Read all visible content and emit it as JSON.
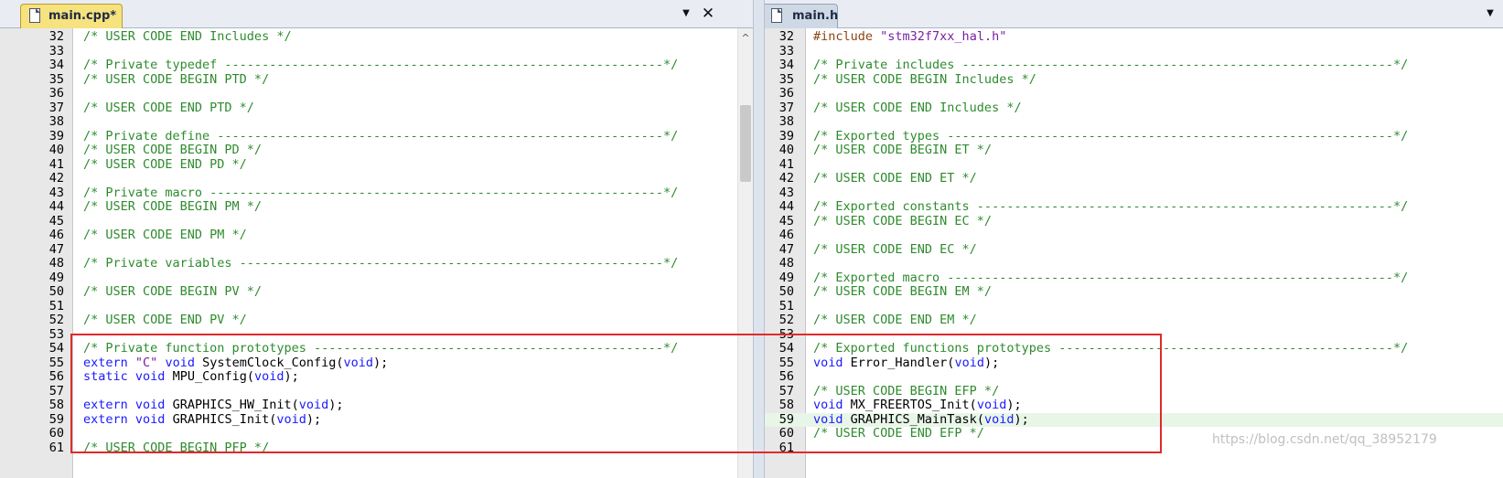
{
  "left_pane": {
    "tab_label": "main.cpp*",
    "lines": [
      {
        "num": "32",
        "tokens": [
          {
            "t": "/* USER CODE END Includes */",
            "c": "comment"
          }
        ]
      },
      {
        "num": "33",
        "tokens": []
      },
      {
        "num": "34",
        "tokens": [
          {
            "t": "/* Private typedef -----------------------------------------------------------*/",
            "c": "comment"
          }
        ]
      },
      {
        "num": "35",
        "tokens": [
          {
            "t": "/* USER CODE BEGIN PTD */",
            "c": "comment"
          }
        ]
      },
      {
        "num": "36",
        "tokens": []
      },
      {
        "num": "37",
        "tokens": [
          {
            "t": "/* USER CODE END PTD */",
            "c": "comment"
          }
        ]
      },
      {
        "num": "38",
        "tokens": []
      },
      {
        "num": "39",
        "tokens": [
          {
            "t": "/* Private define ------------------------------------------------------------*/",
            "c": "comment"
          }
        ]
      },
      {
        "num": "40",
        "tokens": [
          {
            "t": "/* USER CODE BEGIN PD */",
            "c": "comment"
          }
        ]
      },
      {
        "num": "41",
        "tokens": [
          {
            "t": "/* USER CODE END PD */",
            "c": "comment"
          }
        ]
      },
      {
        "num": "42",
        "tokens": []
      },
      {
        "num": "43",
        "tokens": [
          {
            "t": "/* Private macro -------------------------------------------------------------*/",
            "c": "comment"
          }
        ]
      },
      {
        "num": "44",
        "tokens": [
          {
            "t": "/* USER CODE BEGIN PM */",
            "c": "comment"
          }
        ]
      },
      {
        "num": "45",
        "tokens": []
      },
      {
        "num": "46",
        "tokens": [
          {
            "t": "/* USER CODE END PM */",
            "c": "comment"
          }
        ]
      },
      {
        "num": "47",
        "tokens": []
      },
      {
        "num": "48",
        "tokens": [
          {
            "t": "/* Private variables ---------------------------------------------------------*/",
            "c": "comment"
          }
        ]
      },
      {
        "num": "49",
        "tokens": []
      },
      {
        "num": "50",
        "tokens": [
          {
            "t": "/* USER CODE BEGIN PV */",
            "c": "comment"
          }
        ]
      },
      {
        "num": "51",
        "tokens": []
      },
      {
        "num": "52",
        "tokens": [
          {
            "t": "/* USER CODE END PV */",
            "c": "comment"
          }
        ]
      },
      {
        "num": "53",
        "tokens": []
      },
      {
        "num": "54",
        "tokens": [
          {
            "t": "/* Private function prototypes -----------------------------------------------*/",
            "c": "comment"
          }
        ]
      },
      {
        "num": "55",
        "tokens": [
          {
            "t": "extern",
            "c": "keyword"
          },
          {
            "t": " ",
            "c": "plain"
          },
          {
            "t": "\"C\"",
            "c": "string"
          },
          {
            "t": " ",
            "c": "plain"
          },
          {
            "t": "void",
            "c": "keyword"
          },
          {
            "t": " SystemClock_Config(",
            "c": "plain"
          },
          {
            "t": "void",
            "c": "keyword"
          },
          {
            "t": ");",
            "c": "plain"
          }
        ]
      },
      {
        "num": "56",
        "tokens": [
          {
            "t": "static",
            "c": "keyword"
          },
          {
            "t": " ",
            "c": "plain"
          },
          {
            "t": "void",
            "c": "keyword"
          },
          {
            "t": " MPU_Config(",
            "c": "plain"
          },
          {
            "t": "void",
            "c": "keyword"
          },
          {
            "t": ");",
            "c": "plain"
          }
        ]
      },
      {
        "num": "57",
        "tokens": []
      },
      {
        "num": "58",
        "tokens": [
          {
            "t": "extern",
            "c": "keyword"
          },
          {
            "t": " ",
            "c": "plain"
          },
          {
            "t": "void",
            "c": "keyword"
          },
          {
            "t": " GRAPHICS_HW_Init(",
            "c": "plain"
          },
          {
            "t": "void",
            "c": "keyword"
          },
          {
            "t": ");",
            "c": "plain"
          }
        ]
      },
      {
        "num": "59",
        "tokens": [
          {
            "t": "extern",
            "c": "keyword"
          },
          {
            "t": " ",
            "c": "plain"
          },
          {
            "t": "void",
            "c": "keyword"
          },
          {
            "t": " GRAPHICS_Init(",
            "c": "plain"
          },
          {
            "t": "void",
            "c": "keyword"
          },
          {
            "t": ");",
            "c": "plain"
          }
        ]
      },
      {
        "num": "60",
        "tokens": []
      },
      {
        "num": "61",
        "tokens": [
          {
            "t": "/* USER CODE BEGIN PFP */",
            "c": "comment"
          }
        ]
      }
    ]
  },
  "right_pane": {
    "tab_label": "main.h",
    "lines": [
      {
        "num": "32",
        "tokens": [
          {
            "t": "#include ",
            "c": "preproc"
          },
          {
            "t": "\"stm32f7xx_hal.h\"",
            "c": "string"
          }
        ]
      },
      {
        "num": "33",
        "tokens": []
      },
      {
        "num": "34",
        "tokens": [
          {
            "t": "/* Private includes ----------------------------------------------------------*/",
            "c": "comment"
          }
        ]
      },
      {
        "num": "35",
        "tokens": [
          {
            "t": "/* USER CODE BEGIN Includes */",
            "c": "comment"
          }
        ]
      },
      {
        "num": "36",
        "tokens": []
      },
      {
        "num": "37",
        "tokens": [
          {
            "t": "/* USER CODE END Includes */",
            "c": "comment"
          }
        ]
      },
      {
        "num": "38",
        "tokens": []
      },
      {
        "num": "39",
        "tokens": [
          {
            "t": "/* Exported types ------------------------------------------------------------*/",
            "c": "comment"
          }
        ]
      },
      {
        "num": "40",
        "tokens": [
          {
            "t": "/* USER CODE BEGIN ET */",
            "c": "comment"
          }
        ]
      },
      {
        "num": "41",
        "tokens": []
      },
      {
        "num": "42",
        "tokens": [
          {
            "t": "/* USER CODE END ET */",
            "c": "comment"
          }
        ]
      },
      {
        "num": "43",
        "tokens": []
      },
      {
        "num": "44",
        "tokens": [
          {
            "t": "/* Exported constants --------------------------------------------------------*/",
            "c": "comment"
          }
        ]
      },
      {
        "num": "45",
        "tokens": [
          {
            "t": "/* USER CODE BEGIN EC */",
            "c": "comment"
          }
        ]
      },
      {
        "num": "46",
        "tokens": []
      },
      {
        "num": "47",
        "tokens": [
          {
            "t": "/* USER CODE END EC */",
            "c": "comment"
          }
        ]
      },
      {
        "num": "48",
        "tokens": []
      },
      {
        "num": "49",
        "tokens": [
          {
            "t": "/* Exported macro ------------------------------------------------------------*/",
            "c": "comment"
          }
        ]
      },
      {
        "num": "50",
        "tokens": [
          {
            "t": "/* USER CODE BEGIN EM */",
            "c": "comment"
          }
        ]
      },
      {
        "num": "51",
        "tokens": []
      },
      {
        "num": "52",
        "tokens": [
          {
            "t": "/* USER CODE END EM */",
            "c": "comment"
          }
        ]
      },
      {
        "num": "53",
        "tokens": []
      },
      {
        "num": "54",
        "tokens": [
          {
            "t": "/* Exported functions prototypes ---------------------------------------------*/",
            "c": "comment"
          }
        ]
      },
      {
        "num": "55",
        "tokens": [
          {
            "t": "void",
            "c": "keyword"
          },
          {
            "t": " Error_Handler(",
            "c": "plain"
          },
          {
            "t": "void",
            "c": "keyword"
          },
          {
            "t": ");",
            "c": "plain"
          }
        ]
      },
      {
        "num": "56",
        "tokens": []
      },
      {
        "num": "57",
        "tokens": [
          {
            "t": "/* USER CODE BEGIN EFP */",
            "c": "comment"
          }
        ]
      },
      {
        "num": "58",
        "tokens": [
          {
            "t": "void",
            "c": "keyword"
          },
          {
            "t": " MX_FREERTOS_Init(",
            "c": "plain"
          },
          {
            "t": "void",
            "c": "keyword"
          },
          {
            "t": ");",
            "c": "plain"
          }
        ]
      },
      {
        "num": "59",
        "highlight": true,
        "tokens": [
          {
            "t": "void",
            "c": "keyword"
          },
          {
            "t": " GRAPHICS_MainTask(",
            "c": "plain"
          },
          {
            "t": "void",
            "c": "keyword"
          },
          {
            "t": ");",
            "c": "plain"
          }
        ]
      },
      {
        "num": "60",
        "tokens": [
          {
            "t": "/* USER CODE END EFP */",
            "c": "comment"
          }
        ]
      },
      {
        "num": "61",
        "tokens": []
      }
    ]
  },
  "icons": {
    "file": "file-icon",
    "dropdown": "chevron-down-icon",
    "close": "close-icon",
    "scroll_up": "scroll-up-icon"
  },
  "glyphs": {
    "dropdown": "▼",
    "close": "✕",
    "scroll_up": "^"
  },
  "colors": {
    "comment": "#2e8b2e",
    "keyword": "#1a1aff",
    "string": "#7a1fa2",
    "active_tab": "#f6e27e",
    "inactive_tab": "#cfd9e6",
    "annotation_box": "#e02a2a"
  },
  "watermark": "https://blog.csdn.net/qq_38952179"
}
